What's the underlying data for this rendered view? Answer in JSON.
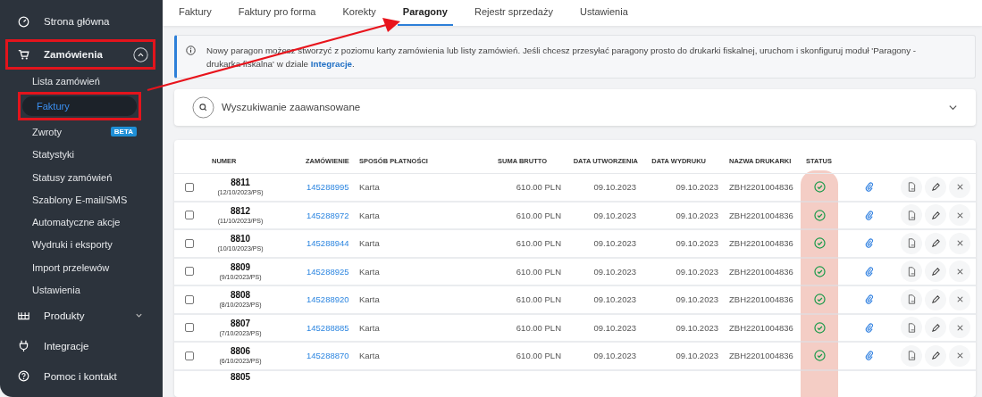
{
  "sidebar": {
    "items": [
      {
        "label": "Strona główna",
        "highlighted": false
      },
      {
        "label": "Zamówienia",
        "expanded": true,
        "highlighted": true,
        "children": [
          {
            "label": "Lista zamówień",
            "selected": false,
            "highlighted": false
          },
          {
            "label": "Faktury",
            "selected": true,
            "highlighted": true
          },
          {
            "label": "Zwroty",
            "selected": false,
            "highlighted": false,
            "badge": "BETA"
          },
          {
            "label": "Statystyki",
            "selected": false,
            "highlighted": false
          },
          {
            "label": "Statusy zamówień",
            "selected": false,
            "highlighted": false
          },
          {
            "label": "Szablony E-mail/SMS",
            "selected": false,
            "highlighted": false
          },
          {
            "label": "Automatyczne akcje",
            "selected": false,
            "highlighted": false
          },
          {
            "label": "Wydruki i eksporty",
            "selected": false,
            "highlighted": false
          },
          {
            "label": "Import przelewów",
            "selected": false,
            "highlighted": false
          },
          {
            "label": "Ustawienia",
            "selected": false,
            "highlighted": false
          }
        ]
      },
      {
        "label": "Produkty",
        "expanded": false,
        "highlighted": false
      },
      {
        "label": "Integracje",
        "highlighted": false
      },
      {
        "label": "Pomoc i kontakt",
        "highlighted": false
      }
    ]
  },
  "tabs": [
    {
      "label": "Faktury",
      "selected": false
    },
    {
      "label": "Faktury pro forma",
      "selected": false
    },
    {
      "label": "Korekty",
      "selected": false
    },
    {
      "label": "Paragony",
      "selected": true
    },
    {
      "label": "Rejestr sprzedaży",
      "selected": false
    },
    {
      "label": "Ustawienia",
      "selected": false
    }
  ],
  "annotation_arrow": true,
  "info": {
    "text": "Nowy paragon możesz stworzyć z poziomu karty zamówienia lub listy zamówień. Jeśli chcesz przesyłać paragony prosto do drukarki fiskalnej, uruchom i skonfiguruj moduł 'Paragony - drukarka fiskalna' w dziale",
    "link": "Integracje",
    "after": "."
  },
  "search": {
    "label": "Wyszukiwanie zaawansowane",
    "expanded": false
  },
  "table": {
    "columns": [
      "NUMER",
      "ZAMÓWIENIE",
      "SPOSÓB PŁATNOŚCI",
      "SUMA BRUTTO",
      "DATA UTWORZENIA",
      "DATA WYDRUKU",
      "NAZWA DRUKARKI",
      "STATUS"
    ],
    "status_column_highlighted": true,
    "rows": [
      {
        "checked": false,
        "number": "8811",
        "doc": "(12/10/2023/PS)",
        "order": "145288995",
        "payment": "Karta",
        "total": "610.00 PLN",
        "created": "09.10.2023",
        "printed": "09.10.2023",
        "printer": "ZBH2201004836",
        "success": true
      },
      {
        "checked": false,
        "number": "8812",
        "doc": "(11/10/2023/PS)",
        "order": "145288972",
        "payment": "Karta",
        "total": "610.00 PLN",
        "created": "09.10.2023",
        "printed": "09.10.2023",
        "printer": "ZBH2201004836",
        "success": true
      },
      {
        "checked": false,
        "number": "8810",
        "doc": "(10/10/2023/PS)",
        "order": "145288944",
        "payment": "Karta",
        "total": "610.00 PLN",
        "created": "09.10.2023",
        "printed": "09.10.2023",
        "printer": "ZBH2201004836",
        "success": true
      },
      {
        "checked": false,
        "number": "8809",
        "doc": "(9/10/2023/PS)",
        "order": "145288925",
        "payment": "Karta",
        "total": "610.00 PLN",
        "created": "09.10.2023",
        "printed": "09.10.2023",
        "printer": "ZBH2201004836",
        "success": true
      },
      {
        "checked": false,
        "number": "8808",
        "doc": "(8/10/2023/PS)",
        "order": "145288920",
        "payment": "Karta",
        "total": "610.00 PLN",
        "created": "09.10.2023",
        "printed": "09.10.2023",
        "printer": "ZBH2201004836",
        "success": true
      },
      {
        "checked": false,
        "number": "8807",
        "doc": "(7/10/2023/PS)",
        "order": "145288885",
        "payment": "Karta",
        "total": "610.00 PLN",
        "created": "09.10.2023",
        "printed": "09.10.2023",
        "printer": "ZBH2201004836",
        "success": true
      },
      {
        "checked": false,
        "number": "8806",
        "doc": "(6/10/2023/PS)",
        "order": "145288870",
        "payment": "Karta",
        "total": "610.00 PLN",
        "created": "09.10.2023",
        "printed": "09.10.2023",
        "printer": "ZBH2201004836",
        "success": true
      }
    ],
    "partial_row": {
      "number": "8805"
    }
  }
}
